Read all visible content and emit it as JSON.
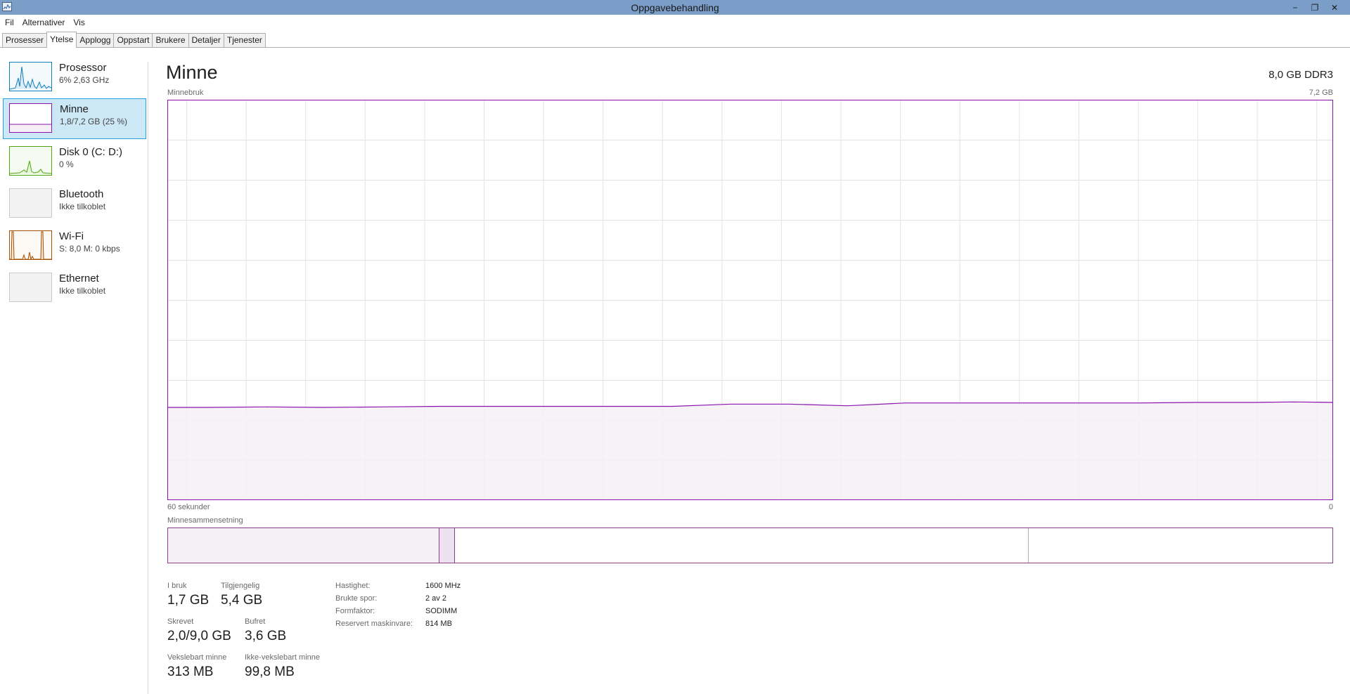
{
  "window": {
    "title": "Oppgavebehandling",
    "controls": {
      "minimize": "−",
      "maximize": "❐",
      "close": "✕"
    }
  },
  "menu": [
    "Fil",
    "Alternativer",
    "Vis"
  ],
  "tabs": [
    {
      "label": "Prosesser",
      "active": false
    },
    {
      "label": "Ytelse",
      "active": true
    },
    {
      "label": "Applogg",
      "active": false
    },
    {
      "label": "Oppstart",
      "active": false
    },
    {
      "label": "Brukere",
      "active": false
    },
    {
      "label": "Detaljer",
      "active": false
    },
    {
      "label": "Tjenester",
      "active": false
    }
  ],
  "sidebar": {
    "items": [
      {
        "name": "Prosessor",
        "sub": "6% 2,63 GHz",
        "icon": "cpu-graph-icon",
        "color": "#117dbb",
        "selected": false
      },
      {
        "name": "Minne",
        "sub": "1,8/7,2 GB (25 %)",
        "icon": "memory-graph-icon",
        "color": "#8b12ae",
        "selected": true
      },
      {
        "name": "Disk 0 (C: D:)",
        "sub": "0 %",
        "icon": "disk-graph-icon",
        "color": "#4da60c",
        "selected": false
      },
      {
        "name": "Bluetooth",
        "sub": "Ikke tilkoblet",
        "icon": "bluetooth-graph-icon",
        "color": "#a7a7a7",
        "selected": false
      },
      {
        "name": "Wi-Fi",
        "sub": "S: 8,0  M: 0 kbps",
        "icon": "wifi-graph-icon",
        "color": "#a74f01",
        "selected": false
      },
      {
        "name": "Ethernet",
        "sub": "Ikke tilkoblet",
        "icon": "ethernet-graph-icon",
        "color": "#a7a7a7",
        "selected": false
      }
    ]
  },
  "main": {
    "title": "Minne",
    "spec": "8,0 GB DDR3",
    "graph": {
      "label": "Minnebruk",
      "max_label": "7,2 GB",
      "time_left": "60 sekunder",
      "time_right": "0",
      "line_color": "#8b12ae",
      "fill_color": "#f4f0f5"
    },
    "composition": {
      "label": "Minnesammensetning",
      "segments": [
        {
          "name": "i-bruk",
          "fraction": 0.233,
          "fill": "#f4f0f5"
        },
        {
          "name": "endret",
          "fraction": 0.013,
          "fill": "#ece2ef"
        },
        {
          "name": "ventemodus",
          "fraction": 0.493,
          "fill": "#ffffff"
        },
        {
          "name": "ledig",
          "fraction": 0.261,
          "fill": "#ffffff"
        }
      ],
      "border_color": "#8b3c8b"
    },
    "stats": {
      "in_use": {
        "label": "I bruk",
        "value": "1,7 GB"
      },
      "available": {
        "label": "Tilgjengelig",
        "value": "5,4 GB"
      },
      "committed": {
        "label": "Skrevet",
        "value": "2,0/9,0 GB"
      },
      "cached": {
        "label": "Bufret",
        "value": "3,6 GB"
      },
      "paged": {
        "label": "Vekslebart minne",
        "value": "313 MB"
      },
      "nonpaged": {
        "label": "Ikke-vekslebart minne",
        "value": "99,8 MB"
      }
    },
    "properties": [
      {
        "key": "Hastighet:",
        "value": "1600 MHz"
      },
      {
        "key": "Brukte spor:",
        "value": "2 av 2"
      },
      {
        "key": "Formfaktor:",
        "value": "SODIMM"
      },
      {
        "key": "Reservert maskinvare:",
        "value": "814 MB"
      }
    ]
  },
  "chart_data": {
    "type": "area",
    "ylabel": "Minnebruk",
    "ylim": [
      0,
      7.2
    ],
    "xlim": [
      60,
      0
    ],
    "x": [
      60,
      58,
      55,
      52,
      49,
      46,
      43,
      40,
      37,
      34,
      31,
      28,
      25,
      22,
      19,
      16,
      13,
      10,
      7,
      4,
      2,
      0
    ],
    "series": [
      {
        "values": [
          1.66,
          1.66,
          1.67,
          1.66,
          1.67,
          1.68,
          1.68,
          1.68,
          1.68,
          1.68,
          1.72,
          1.72,
          1.69,
          1.74,
          1.74,
          1.74,
          1.74,
          1.74,
          1.75,
          1.75,
          1.76,
          1.75
        ]
      }
    ]
  }
}
